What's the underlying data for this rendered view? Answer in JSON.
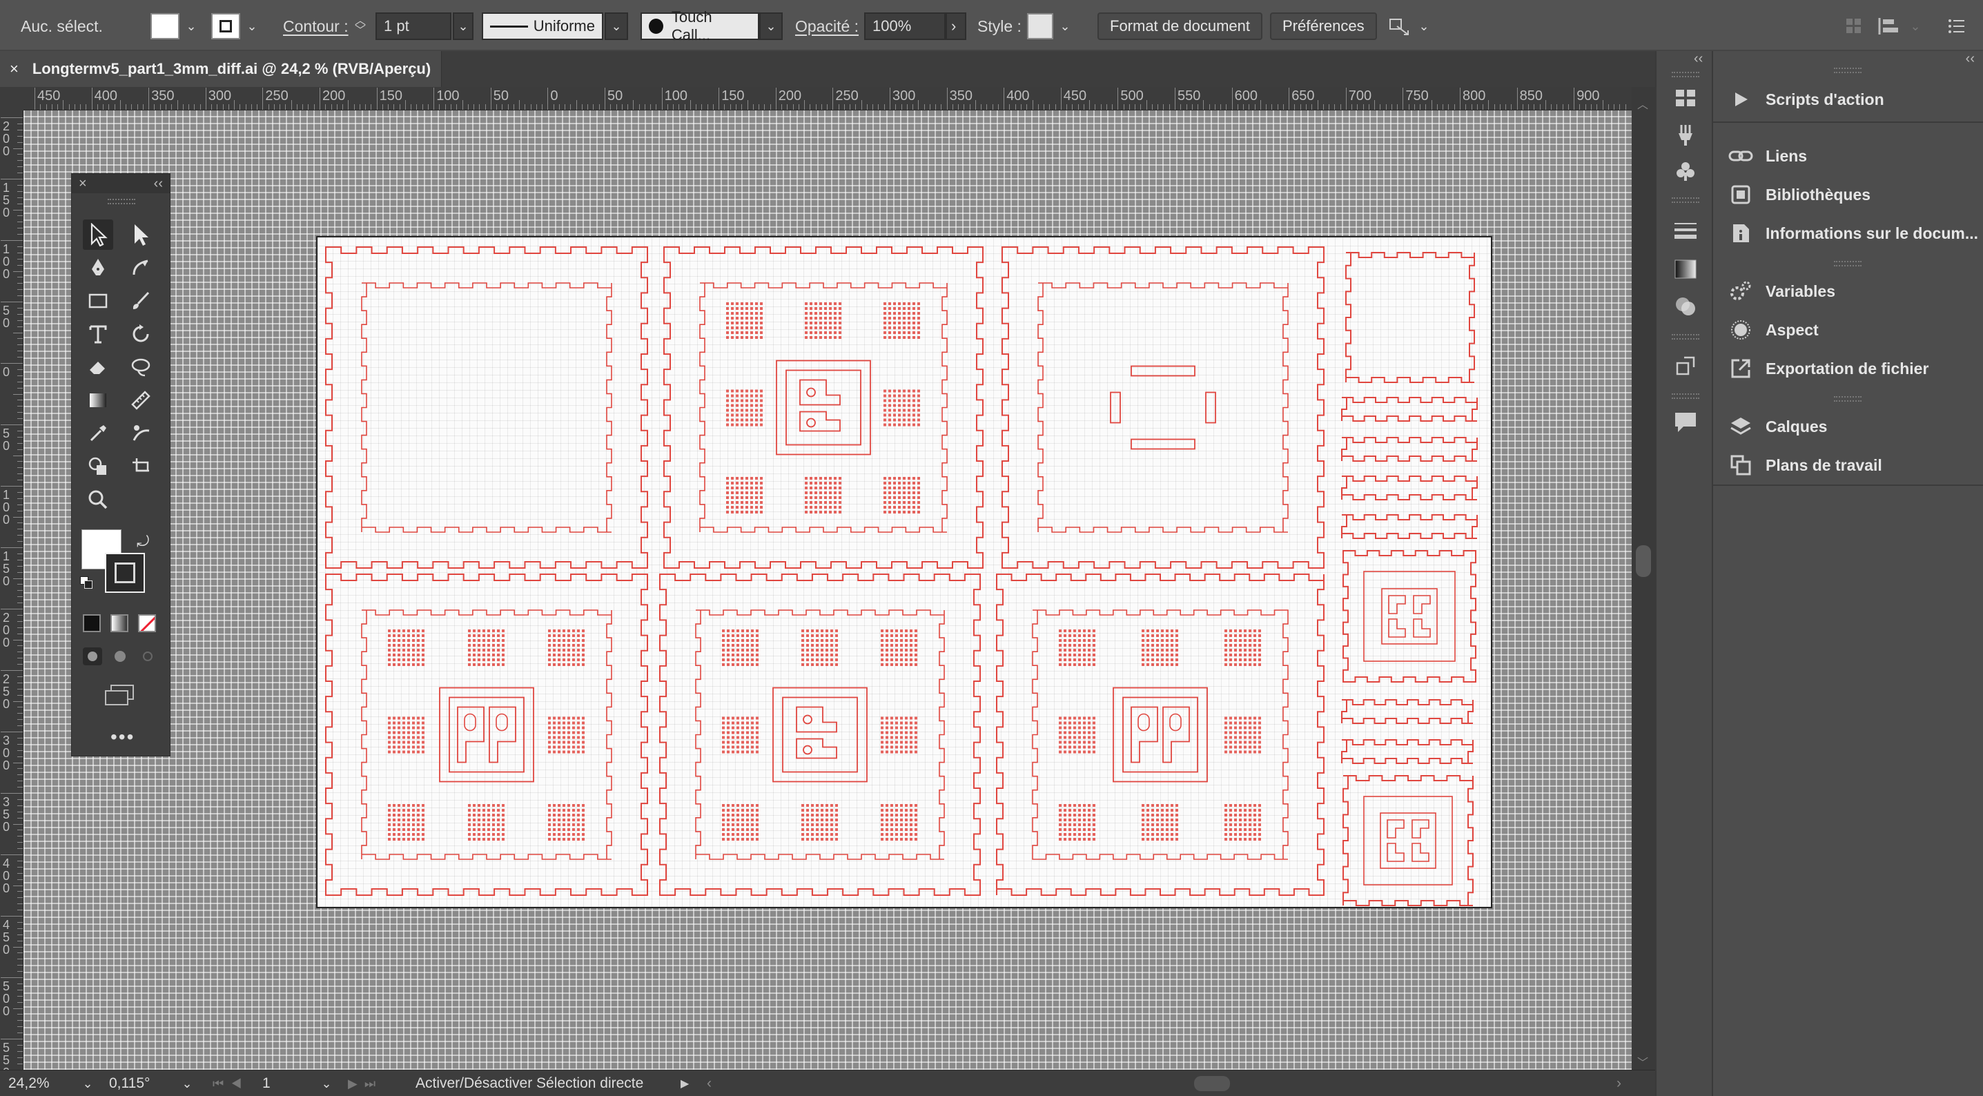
{
  "controlbar": {
    "selection_label": "Auc. sélect.",
    "contour_label": "Contour :",
    "stroke_weight": "1 pt",
    "stroke_profile": "Uniforme",
    "brush": "Touch Call...",
    "opacity_label": "Opacité :",
    "opacity_value": "100%",
    "style_label": "Style :",
    "doc_format_button": "Format de document",
    "preferences_button": "Préférences"
  },
  "document_tab": {
    "title": "Longtermv5_part1_3mm_diff.ai @ 24,2 % (RVB/Aperçu)"
  },
  "rulers": {
    "top_ticks": [
      "450",
      "400",
      "350",
      "300",
      "250",
      "200",
      "150",
      "100",
      "50",
      "0",
      "50",
      "100",
      "150",
      "200",
      "250",
      "300",
      "350",
      "400",
      "450",
      "500",
      "550",
      "600",
      "650",
      "700",
      "750",
      "800",
      "850",
      "900"
    ],
    "left_ticks": [
      "2\n0\n0",
      "1\n5\n0",
      "1\n0\n0",
      "5\n0",
      "0",
      "5\n0",
      "1\n0\n0",
      "1\n5\n0",
      "2\n0\n0",
      "2\n5\n0",
      "3\n0\n0",
      "3\n5\n0",
      "4\n0\n0",
      "4\n5\n0",
      "5\n0\n0",
      "5\n5\n0"
    ]
  },
  "panels": {
    "items": [
      {
        "label": "Scripts d'action",
        "icon": "play-icon"
      },
      {
        "label": "Liens",
        "icon": "link-icon"
      },
      {
        "label": "Bibliothèques",
        "icon": "library-icon"
      },
      {
        "label": "Informations sur le docum...",
        "icon": "info-icon"
      },
      {
        "label": "Variables",
        "icon": "variables-icon"
      },
      {
        "label": "Aspect",
        "icon": "appearance-icon"
      },
      {
        "label": "Exportation de fichier",
        "icon": "export-icon"
      },
      {
        "label": "Calques",
        "icon": "layers-icon"
      },
      {
        "label": "Plans de travail",
        "icon": "artboards-icon"
      }
    ]
  },
  "statusbar": {
    "zoom": "24,2%",
    "rotation": "0,115°",
    "artboard_number": "1",
    "status_text": "Activer/Désactiver Sélection directe"
  },
  "colors": {
    "accent_red": "#e0463f",
    "canvas_grey": "#8a8a8a",
    "ui_dark": "#535353"
  }
}
